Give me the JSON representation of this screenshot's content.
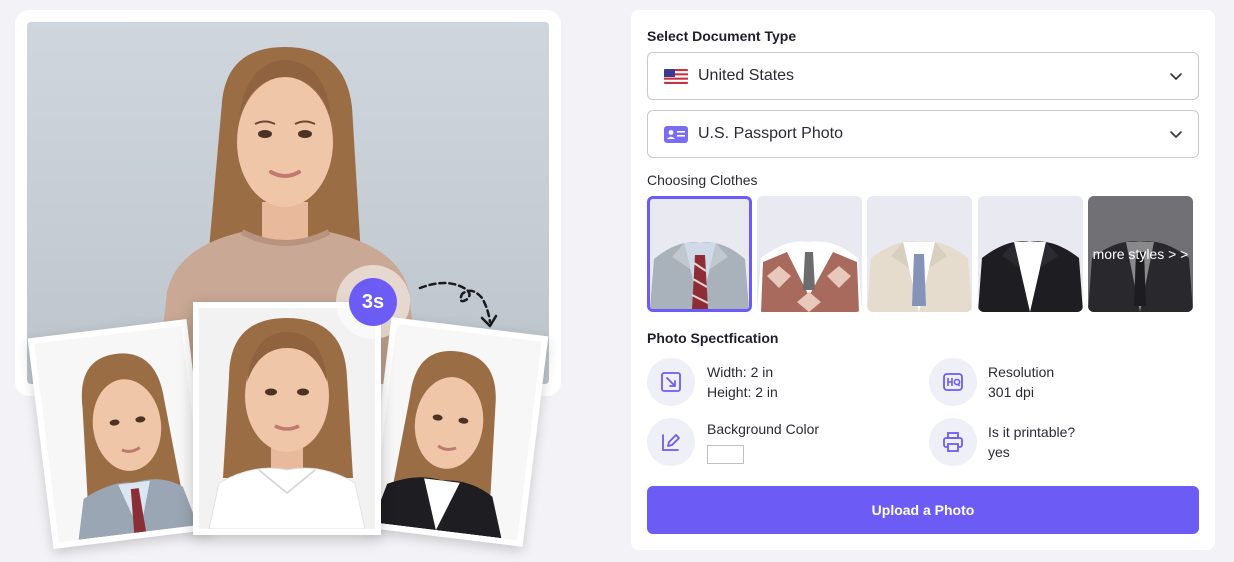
{
  "hero": {
    "timer_label": "3s"
  },
  "document": {
    "section_title": "Select Document Type",
    "country": {
      "value": "United States",
      "icon": "us-flag-icon"
    },
    "doc_type": {
      "value": "U.S. Passport Photo",
      "icon": "id-card-icon"
    }
  },
  "clothes": {
    "section_title": "Choosing Clothes",
    "options": [
      {
        "name": "gray-suit-striped-tie",
        "selected": true
      },
      {
        "name": "argyle-vest"
      },
      {
        "name": "beige-suit-blue-tie"
      },
      {
        "name": "black-suit"
      },
      {
        "name": "more-styles",
        "label": "more styles > >"
      }
    ]
  },
  "spec": {
    "section_title": "Photo Spectfication",
    "width": "Width: 2 in",
    "height": "Height: 2 in",
    "resolution_label": "Resolution",
    "resolution_value": "301 dpi",
    "bg_label": "Background Color",
    "bg_color": "#ffffff",
    "printable_label": "Is it printable?",
    "printable_value": "yes"
  },
  "upload": {
    "label": "Upload a Photo"
  },
  "colors": {
    "accent": "#6c5cf5",
    "panel_bg": "#ffffff",
    "page_bg": "#f3f3f7"
  }
}
